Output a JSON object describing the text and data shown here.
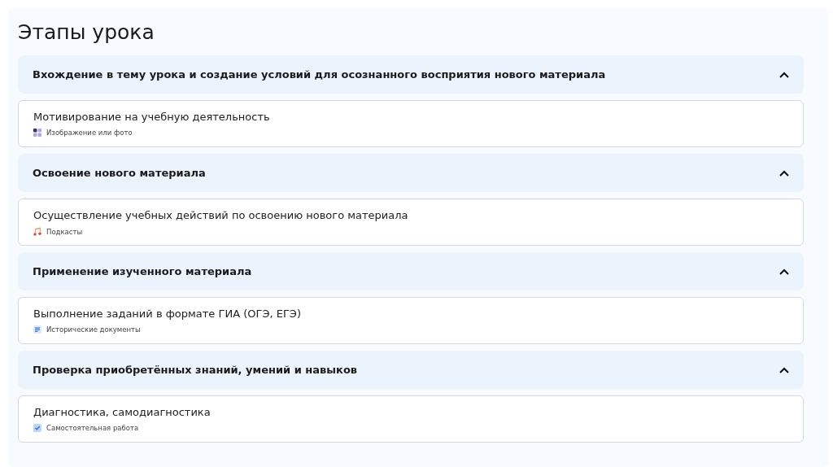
{
  "title": "Этапы урока",
  "stages": [
    {
      "title": "Вхождение в тему урока и создание условий для осознанного восприятия нового материала",
      "expanded": true,
      "activity": {
        "title": "Мотивирование на учебную деятельность",
        "material": {
          "kind": "image",
          "label": "Изображение или фото"
        }
      }
    },
    {
      "title": "Освоение нового материала",
      "expanded": true,
      "activity": {
        "title": "Осуществление учебных действий по освоению нового материала",
        "material": {
          "kind": "podcast",
          "label": "Подкасты"
        }
      }
    },
    {
      "title": "Применение изученного материала",
      "expanded": true,
      "activity": {
        "title": "Выполнение заданий в формате ГИА (ОГЭ, ЕГЭ)",
        "material": {
          "kind": "document",
          "label": "Исторические документы"
        }
      }
    },
    {
      "title": "Проверка приобретённых знаний, умений и навыков",
      "expanded": true,
      "activity": {
        "title": "Диагностика, самодиагностика",
        "material": {
          "kind": "task",
          "label": "Самостоятельная работа"
        }
      }
    }
  ]
}
